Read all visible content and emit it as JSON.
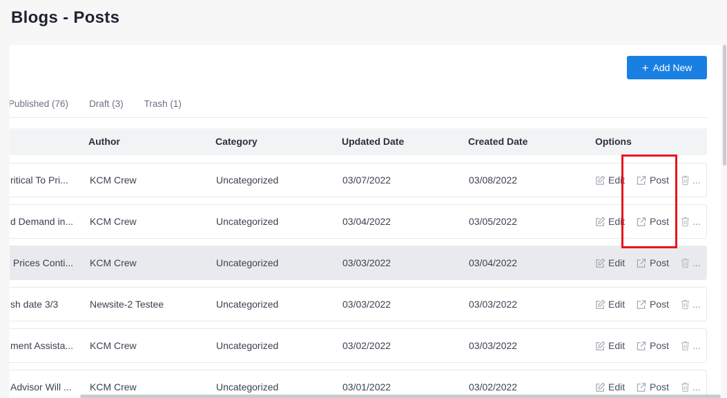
{
  "page": {
    "title": "Blogs - Posts"
  },
  "toolbar": {
    "add_label": "Add New"
  },
  "tabs": [
    {
      "label": "Published (76)"
    },
    {
      "label": "Draft (3)"
    },
    {
      "label": "Trash (1)"
    }
  ],
  "table": {
    "columns": {
      "author": "Author",
      "category": "Category",
      "updated": "Updated Date",
      "created": "Created Date",
      "options": "Options"
    },
    "option_labels": {
      "edit": "Edit",
      "post": "Post",
      "more": "..."
    },
    "rows": [
      {
        "title": "ritical To Pri...",
        "author": "KCM Crew",
        "category": "Uncategorized",
        "updated": "03/07/2022",
        "created": "03/08/2022",
        "highlighted": false
      },
      {
        "title": "d Demand in...",
        "author": "KCM Crew",
        "category": "Uncategorized",
        "updated": "03/04/2022",
        "created": "03/05/2022",
        "highlighted": false
      },
      {
        "title": " Prices Conti...",
        "author": "KCM Crew",
        "category": "Uncategorized",
        "updated": "03/03/2022",
        "created": "03/04/2022",
        "highlighted": true
      },
      {
        "title": "sh date 3/3",
        "author": "Newsite-2 Testee",
        "category": "Uncategorized",
        "updated": "03/03/2022",
        "created": "03/03/2022",
        "highlighted": false
      },
      {
        "title": "ment Assista...",
        "author": "KCM Crew",
        "category": "Uncategorized",
        "updated": "03/02/2022",
        "created": "03/03/2022",
        "highlighted": false
      },
      {
        "title": "Advisor Will ...",
        "author": "KCM Crew",
        "category": "Uncategorized",
        "updated": "03/01/2022",
        "created": "03/02/2022",
        "highlighted": false
      }
    ]
  },
  "colors": {
    "primary": "#1a7fe3",
    "highlight_row": "#e9eaed",
    "annotation_box": "#e5161c"
  }
}
